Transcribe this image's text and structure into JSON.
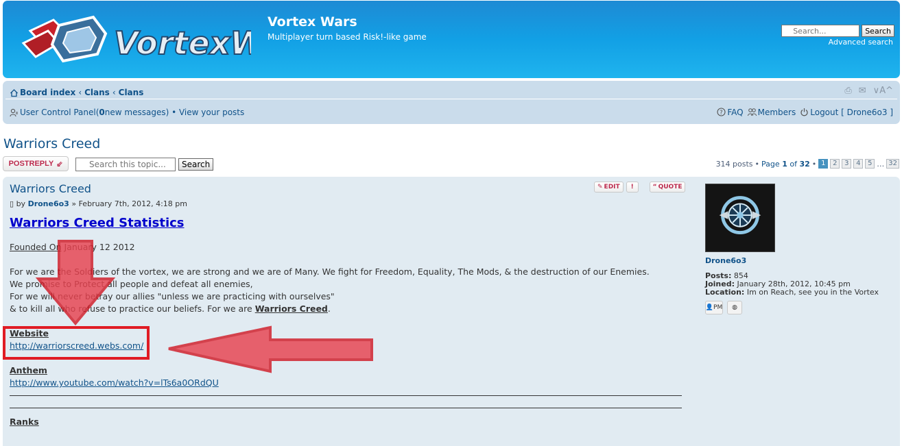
{
  "header": {
    "logo_text": "VortexWars",
    "site_title": "Vortex Wars",
    "site_description": "Multiplayer turn based Risk!-like game",
    "search_placeholder": "Search...",
    "search_button": "Search",
    "advanced_search": "Advanced search"
  },
  "navbar": {
    "breadcrumbs": [
      "Board index",
      "Clans",
      "Clans"
    ],
    "ucp_label": "User Control Panel",
    "new_messages_prefix": " (",
    "new_messages_count": "0",
    "new_messages_suffix": " new messages)",
    "separator": " • ",
    "view_posts": "View your posts",
    "faq": "FAQ",
    "members": "Members",
    "logout": "Logout [ Drone6o3 ]",
    "font_toggle": "A"
  },
  "topic": {
    "title": "Warriors Creed",
    "postreply_label": "POSTREPLY",
    "search_placeholder": "Search this topic...",
    "search_button": "Search",
    "posts_count": "314 posts",
    "page_prefix": "Page",
    "page_current": "1",
    "page_of": "of",
    "page_total": "32",
    "pages": [
      "1",
      "2",
      "3",
      "4",
      "5"
    ],
    "ellipsis": "…",
    "last_page": "32"
  },
  "post": {
    "title": "Warriors Creed",
    "edit_label": "EDIT",
    "warn_label": "!",
    "quote_label": "QUOTE",
    "by": "by",
    "author": "Drone6o3",
    "date": "» February 7th, 2012, 4:18 pm",
    "heading": "Warriors Creed Statistics",
    "founded_label": "Founded On",
    "founded_value": " January 12 2012",
    "para1": "For we are the Soldiers of the vortex, we are strong and we are of Many. We fight for Freedom, Equality, The Mods, & the destruction of our Enemies.",
    "para2": "We promise to Protect all people and defeat all enemies,",
    "para3": "For we will never betray our allies \"unless we are practicing with ourselves\"",
    "para4_prefix": "& to kill all who refuse to practice our beliefs. For we are ",
    "para4_bold": "Warriors Creed",
    "para4_suffix": ".",
    "website_label": "Website",
    "website_url": "http://warriorscreed.webs.com/",
    "anthem_label": "Anthem",
    "anthem_url": "http://www.youtube.com/watch?v=lTs6a0ORdQU",
    "ranks_label": "Ranks"
  },
  "profile": {
    "username": "Drone6o3",
    "posts_label": "Posts:",
    "posts_value": "854",
    "joined_label": "Joined:",
    "joined_value": "January 28th, 2012, 10:45 pm",
    "location_label": "Location:",
    "location_value": "Im on Reach, see you in the Vortex",
    "pm_label": "PM"
  },
  "colors": {
    "header_blue": "#12a0e5",
    "link_blue": "#105289",
    "post_bg": "#e1ebf2",
    "arrow_red": "#e8424f"
  }
}
